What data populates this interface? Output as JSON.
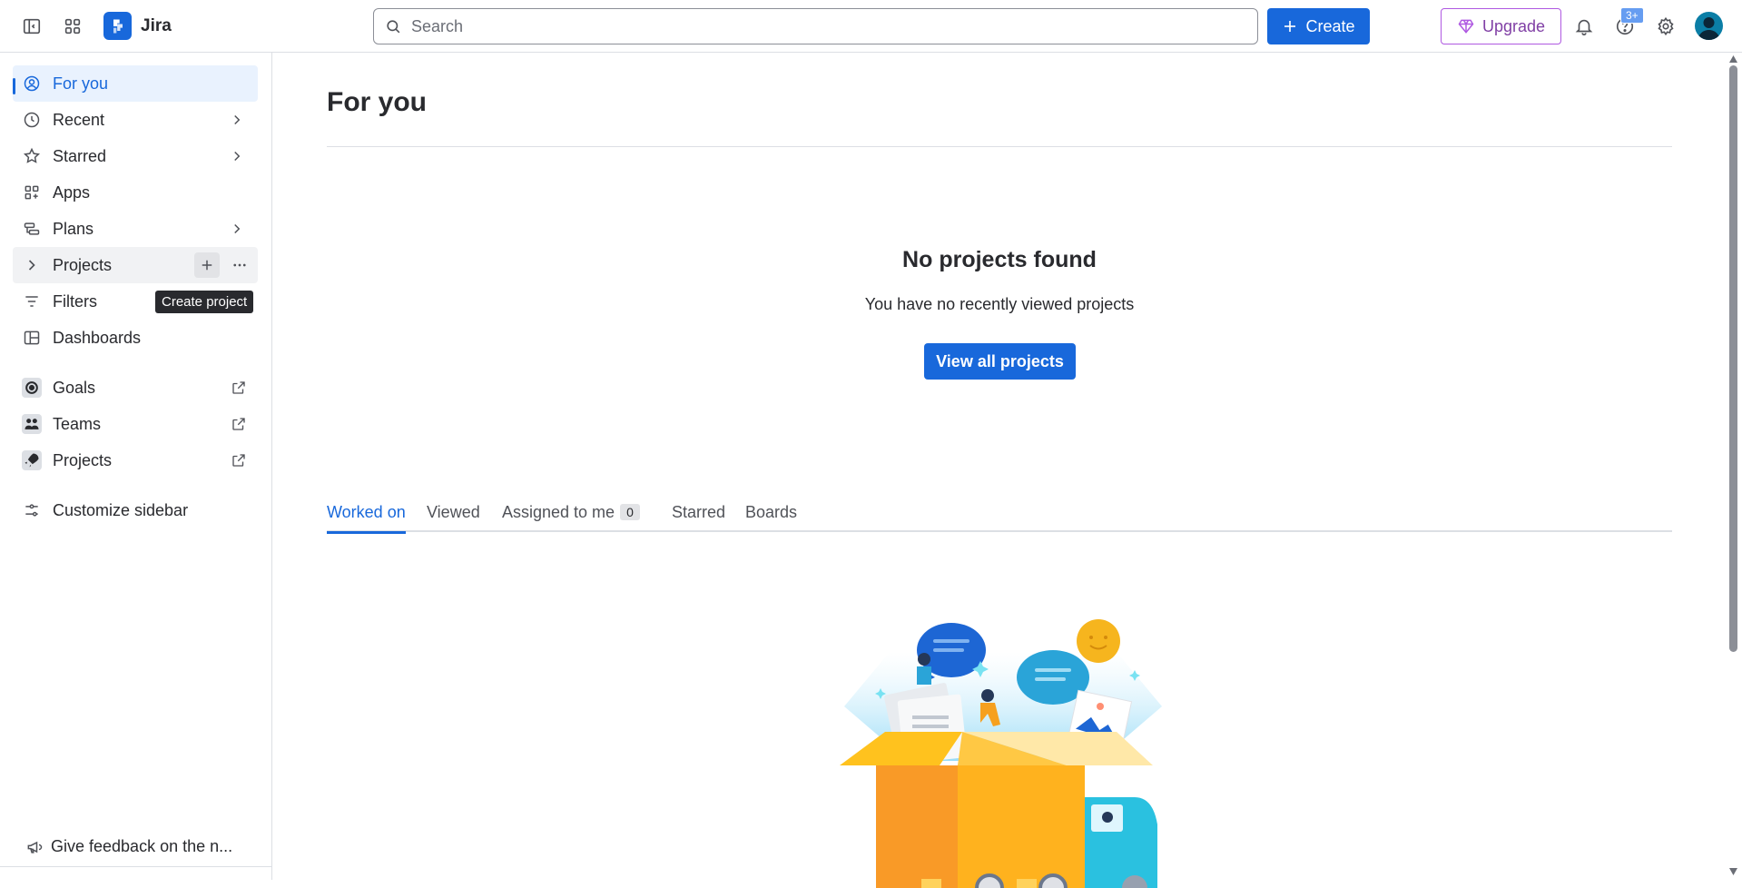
{
  "topbar": {
    "app_name": "Jira",
    "search_placeholder": "Search",
    "create_label": "Create",
    "upgrade_label": "Upgrade",
    "help_badge": "3+"
  },
  "sidebar": {
    "items": [
      {
        "label": "For you",
        "icon": "user-circle-icon"
      },
      {
        "label": "Recent",
        "icon": "clock-icon"
      },
      {
        "label": "Starred",
        "icon": "star-icon"
      },
      {
        "label": "Apps",
        "icon": "apps-icon"
      },
      {
        "label": "Plans",
        "icon": "plans-icon"
      },
      {
        "label": "Projects",
        "icon": "chevron-right-icon"
      },
      {
        "label": "Filters",
        "icon": "filter-icon"
      },
      {
        "label": "Dashboards",
        "icon": "dashboard-icon"
      },
      {
        "label": "Goals",
        "icon": "goals-icon"
      },
      {
        "label": "Teams",
        "icon": "teams-icon"
      },
      {
        "label": "Projects",
        "icon": "rocket-icon"
      },
      {
        "label": "Customize sidebar",
        "icon": "customize-icon"
      }
    ],
    "tooltip": "Create project",
    "feedback": "Give feedback on the n..."
  },
  "main": {
    "title": "For you",
    "empty_title": "No projects found",
    "empty_subtitle": "You have no recently viewed projects",
    "view_all_label": "View all projects",
    "tabs": [
      {
        "label": "Worked on"
      },
      {
        "label": "Viewed"
      },
      {
        "label": "Assigned to me",
        "count": "0"
      },
      {
        "label": "Starred"
      },
      {
        "label": "Boards"
      }
    ]
  },
  "colors": {
    "brand": "#1868db",
    "upgrade": "#803fa5",
    "active_bg": "#e9f2fe"
  }
}
